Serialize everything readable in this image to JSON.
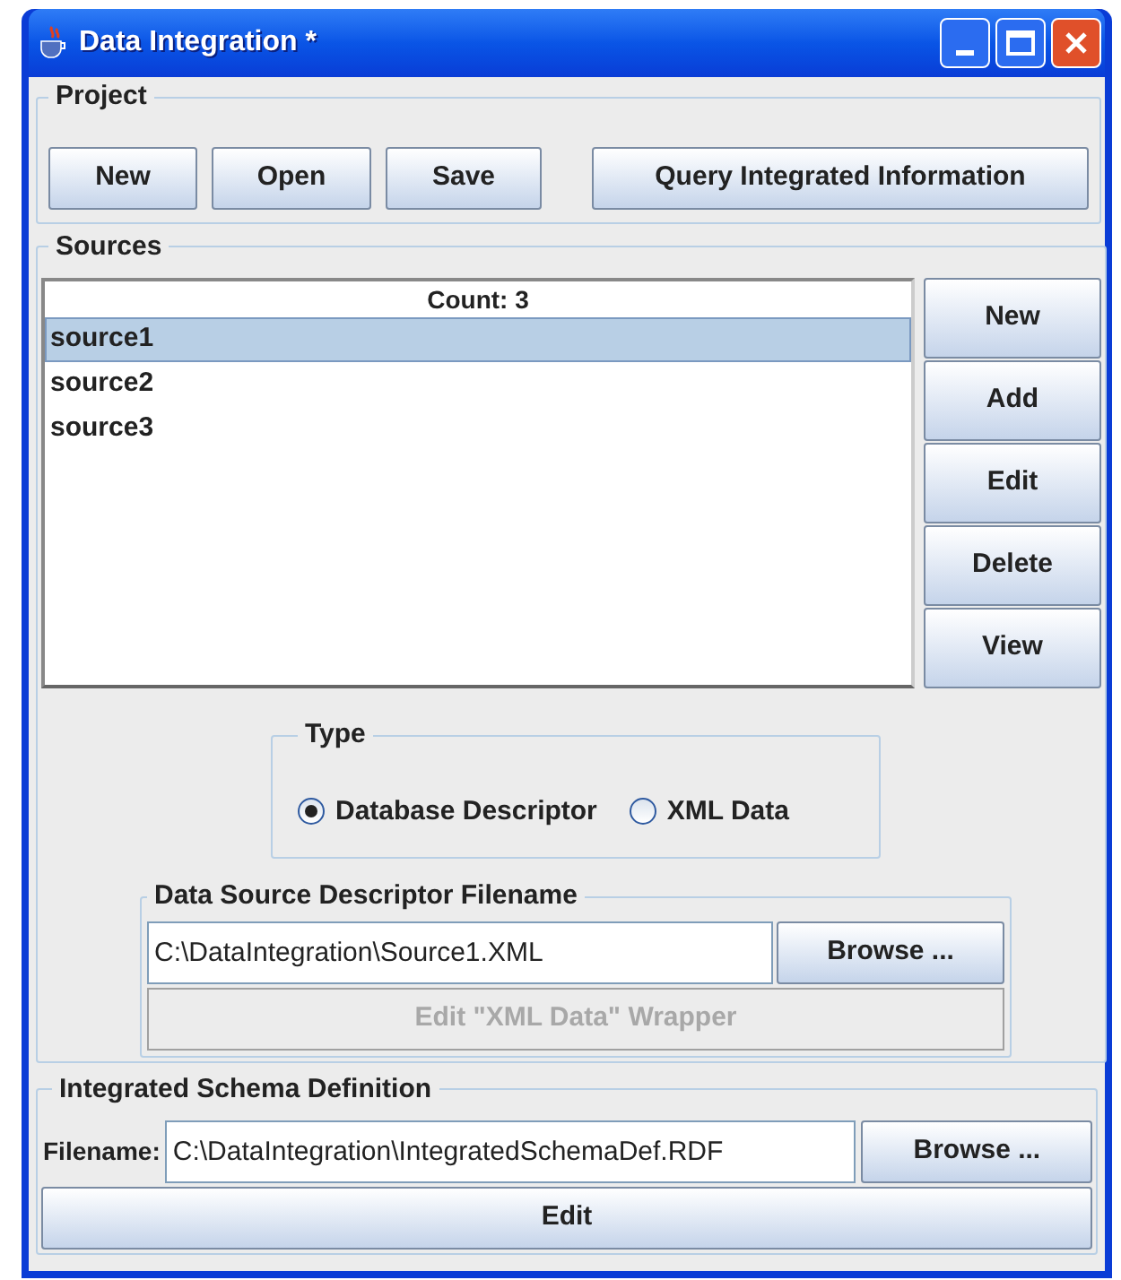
{
  "window": {
    "title": "Data Integration *"
  },
  "project": {
    "title": "Project",
    "buttons": [
      "New",
      "Open",
      "Save",
      "Query Integrated Information"
    ]
  },
  "sources": {
    "title": "Sources",
    "count_label": "Count: 3",
    "items": [
      {
        "label": "source1",
        "selected": true
      },
      {
        "label": "source2",
        "selected": false
      },
      {
        "label": "source3",
        "selected": false
      }
    ],
    "buttons": [
      "New",
      "Add",
      "Edit",
      "Delete",
      "View"
    ],
    "type": {
      "title": "Type",
      "options": [
        {
          "label": "Database Descriptor",
          "selected": true
        },
        {
          "label": "XML Data",
          "selected": false
        }
      ]
    },
    "descriptor": {
      "title": "Data Source Descriptor Filename",
      "value": "C:\\DataIntegration\\Source1.XML",
      "browse": "Browse ...",
      "wrapper_button": {
        "label": "Edit \"XML Data\" Wrapper",
        "disabled": true
      }
    }
  },
  "schema": {
    "title": "Integrated Schema Definition",
    "filename_label": "Filename:",
    "value": "C:\\DataIntegration\\IntegratedSchemaDef.RDF",
    "browse": "Browse ...",
    "edit": "Edit"
  }
}
